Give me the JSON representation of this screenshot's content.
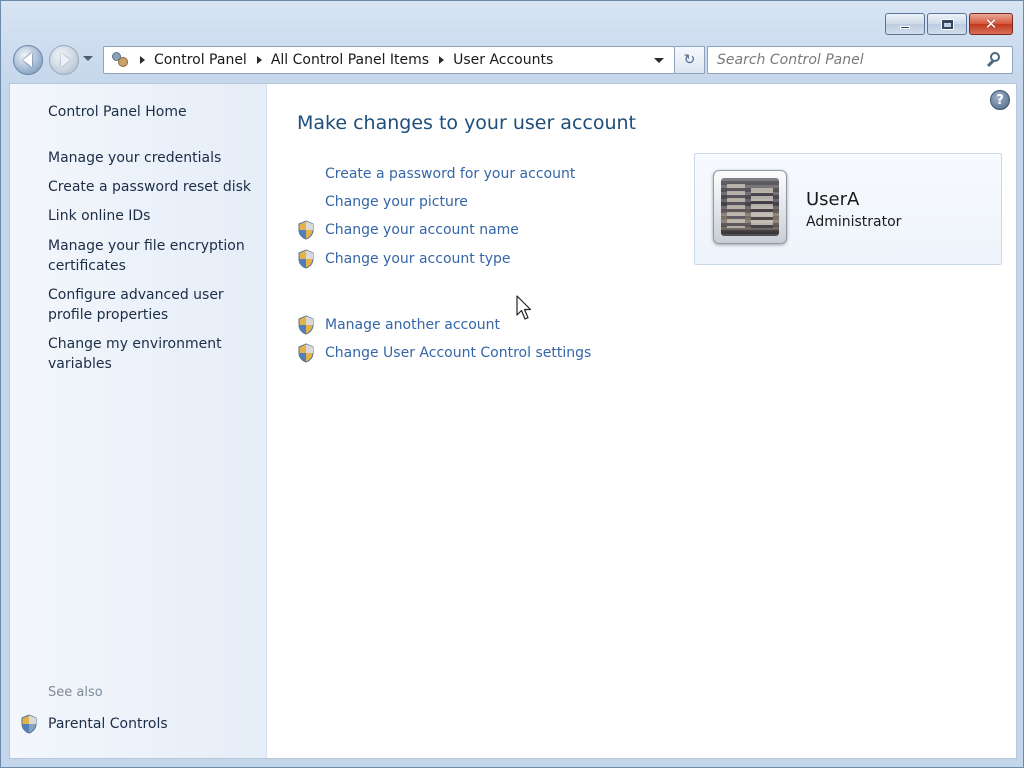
{
  "window": {
    "minimize_label": "–",
    "maximize_label": "□",
    "close_label": "✕"
  },
  "navigation": {
    "breadcrumbs": [
      "Control Panel",
      "All Control Panel Items",
      "User Accounts"
    ],
    "search_placeholder": "Search Control Panel",
    "refresh_glyph": "↻"
  },
  "sidebar": {
    "home": "Control Panel Home",
    "links": [
      "Manage your credentials",
      "Create a password reset disk",
      "Link online IDs",
      "Manage your file encryption certificates",
      "Configure advanced user profile properties",
      "Change my environment variables"
    ],
    "see_also": "See also",
    "parental_controls": "Parental Controls"
  },
  "main": {
    "title": "Make changes to your user account",
    "tasks": [
      {
        "label": "Create a password for your account",
        "shield": false
      },
      {
        "label": "Change your picture",
        "shield": false
      },
      {
        "label": "Change your account name",
        "shield": true
      },
      {
        "label": "Change your account type",
        "shield": true
      },
      {
        "label": "Manage another account",
        "shield": true
      },
      {
        "label": "Change User Account Control settings",
        "shield": true
      }
    ],
    "help_label": "?"
  },
  "user": {
    "name": "UserA",
    "role": "Administrator"
  },
  "colors": {
    "link": "#3466a8",
    "title": "#1e4e79",
    "sidebar_text": "#1c2d46",
    "see_also": "#7f8a99"
  }
}
